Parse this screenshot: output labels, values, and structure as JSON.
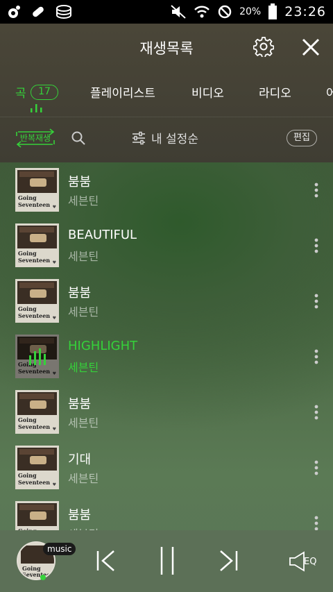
{
  "status_bar": {
    "battery": "20%",
    "time": "23:26",
    "icons": [
      "app-logo-icon",
      "pill-icon",
      "cloud-stack-icon",
      "mute-icon",
      "wifi-icon",
      "do-not-disturb-icon",
      "battery-icon"
    ]
  },
  "header": {
    "title": "재생목록",
    "tabs": [
      {
        "label": "곡",
        "badge": "17",
        "active": true
      },
      {
        "label": "플레이리스트"
      },
      {
        "label": "비디오"
      },
      {
        "label": "라디오"
      },
      {
        "label": "어"
      }
    ]
  },
  "toolbar": {
    "repeat_label": "반복재생",
    "sort_label": "내 설정순",
    "edit_label": "편집"
  },
  "songs": [
    {
      "title": "붐붐",
      "artist": "세븐틴",
      "active": false
    },
    {
      "title": "BEAUTIFUL",
      "artist": "세븐틴",
      "active": false
    },
    {
      "title": "붐붐",
      "artist": "세븐틴",
      "active": false
    },
    {
      "title": "HIGHLIGHT",
      "artist": "세븐틴",
      "active": true
    },
    {
      "title": "붐붐",
      "artist": "세븐틴",
      "active": false
    },
    {
      "title": "기대",
      "artist": "세븐틴",
      "active": false
    },
    {
      "title": "붐붐",
      "artist": "세븐틴",
      "active": false
    }
  ],
  "album_cover_text": "Going\nSeventeen",
  "player": {
    "badge": "music",
    "eq_label": "EQ"
  },
  "colors": {
    "accent": "#35d23a",
    "header_bg": "#3f3d33",
    "player_bg": "#5c7058"
  }
}
